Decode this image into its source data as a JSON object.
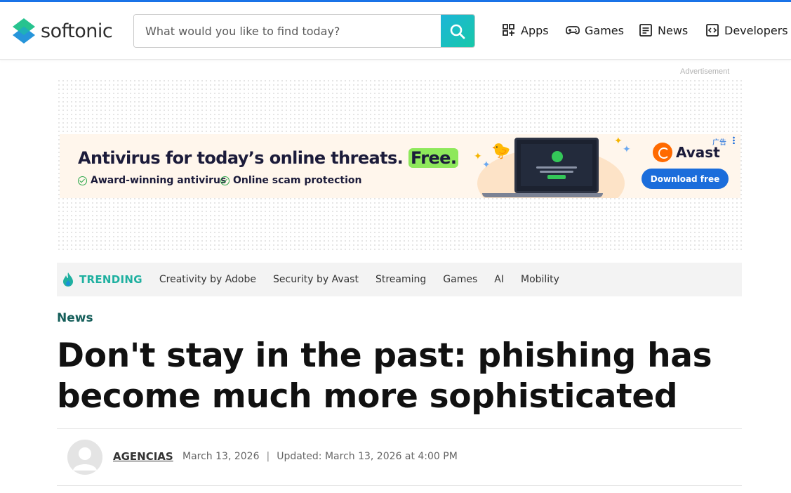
{
  "header": {
    "logo_text": "softonic",
    "search": {
      "placeholder": "What would you like to find today?"
    },
    "nav": [
      {
        "label": "Apps",
        "icon": "apps-grid-icon"
      },
      {
        "label": "Games",
        "icon": "gamepad-icon"
      },
      {
        "label": "News",
        "icon": "newspaper-icon"
      },
      {
        "label": "Developers",
        "icon": "code-icon"
      }
    ]
  },
  "ad": {
    "label": "Advertisement",
    "headline_main": "Antivirus for today’s online threats.",
    "headline_highlight": "Free.",
    "features": [
      "Award-winning antivirus",
      "Online scam protection"
    ],
    "brand": "Avast",
    "cta": "Download free",
    "corner_label": "广告",
    "colors": {
      "brand": "#ff6a00",
      "cta": "#1b6ddb",
      "highlight": "#8ee85b"
    }
  },
  "trending": {
    "title": "TRENDING",
    "items": [
      "Creativity by Adobe",
      "Security by Avast",
      "Streaming",
      "Games",
      "AI",
      "Mobility"
    ]
  },
  "article": {
    "section": "News",
    "title": "Don't stay in the past: phishing has become much more sophisticated",
    "author": "AGENCIAS",
    "date": "March 13, 2026",
    "separator": "|",
    "updated": "Updated: March 13, 2026 at 4:00 PM"
  }
}
